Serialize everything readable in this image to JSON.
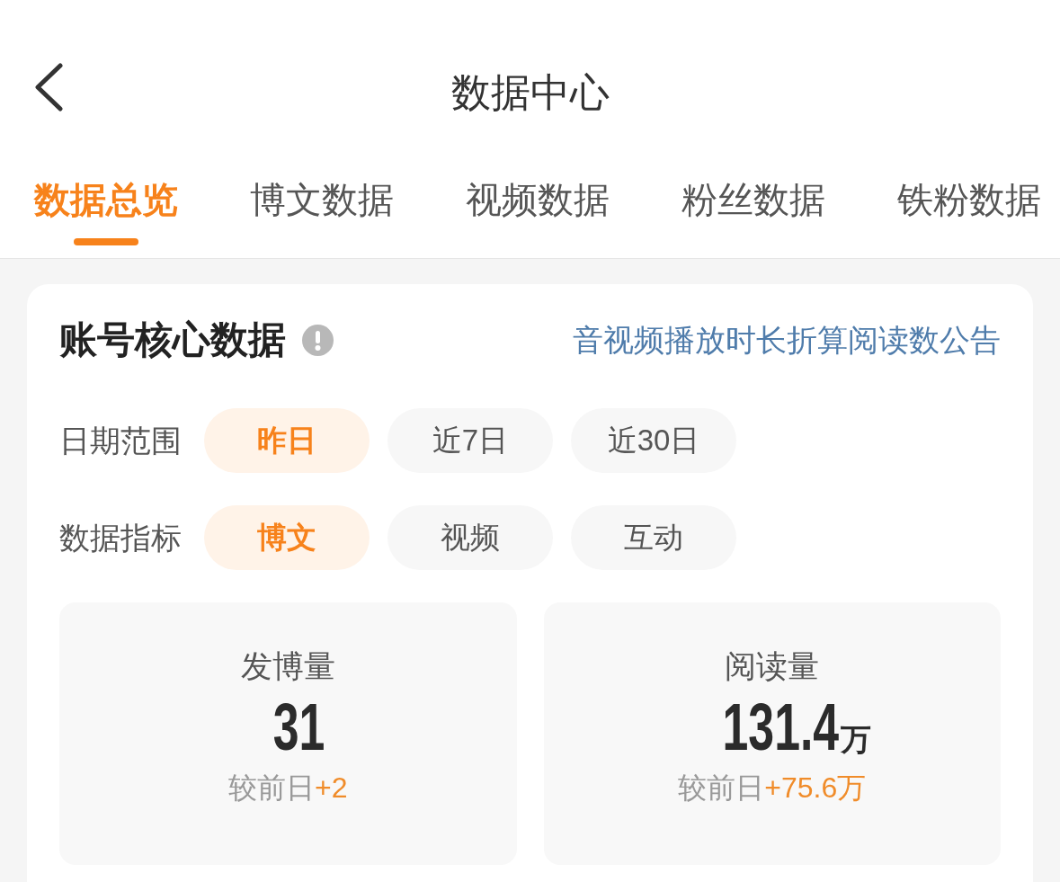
{
  "header": {
    "title": "数据中心"
  },
  "tabs": [
    {
      "label": "数据总览",
      "selected": true
    },
    {
      "label": "博文数据",
      "selected": false
    },
    {
      "label": "视频数据",
      "selected": false
    },
    {
      "label": "粉丝数据",
      "selected": false
    },
    {
      "label": "铁粉数据",
      "selected": false
    }
  ],
  "card": {
    "title": "账号核心数据",
    "notice_link": "音视频播放时长折算阅读数公告",
    "filters": [
      {
        "label": "日期范围",
        "options": [
          {
            "label": "昨日",
            "selected": true
          },
          {
            "label": "近7日",
            "selected": false
          },
          {
            "label": "近30日",
            "selected": false
          }
        ]
      },
      {
        "label": "数据指标",
        "options": [
          {
            "label": "博文",
            "selected": true
          },
          {
            "label": "视频",
            "selected": false
          },
          {
            "label": "互动",
            "selected": false
          }
        ]
      }
    ],
    "stats": [
      {
        "label": "发博量",
        "value": "31",
        "compare_label": "较前日",
        "change": "+2"
      },
      {
        "label": "阅读量",
        "value": "131.4",
        "unit": "万",
        "compare_label": "较前日",
        "change": "+75.6万"
      }
    ]
  }
}
